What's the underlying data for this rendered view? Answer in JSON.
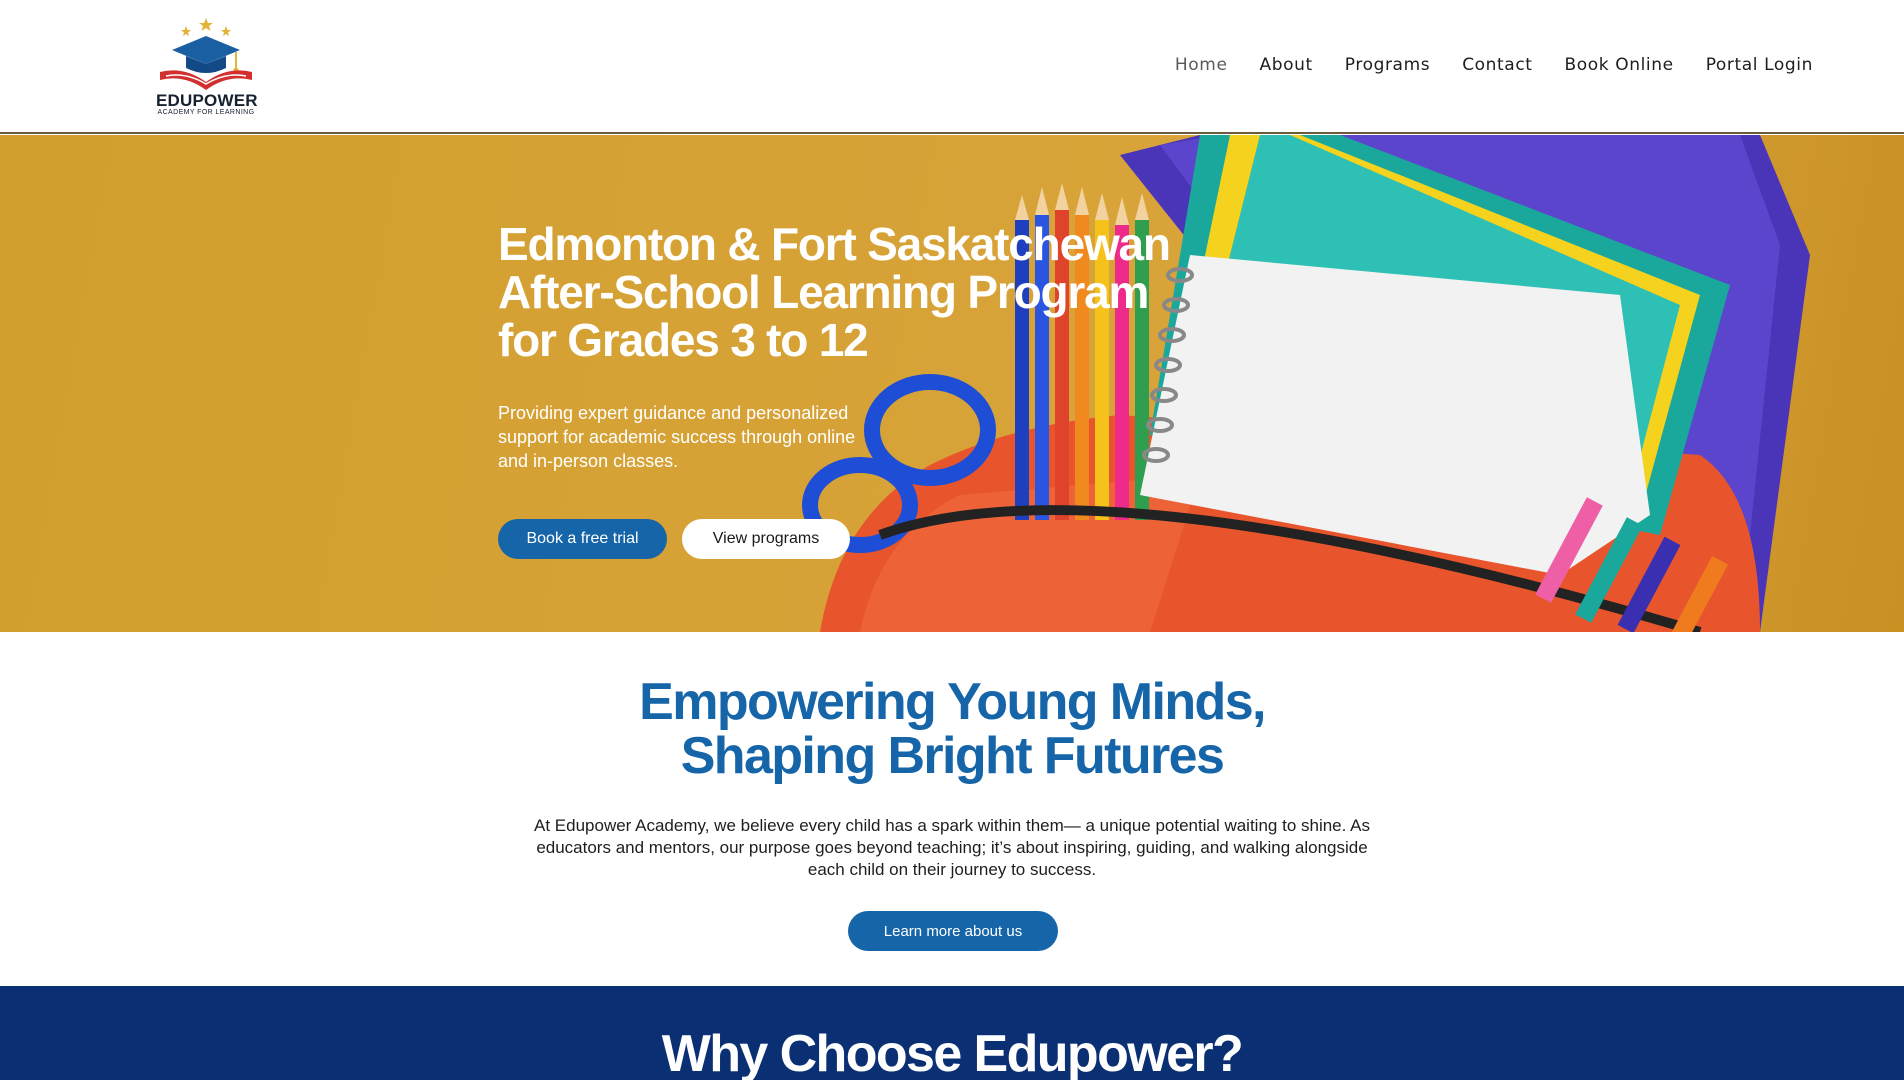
{
  "brand": {
    "name": "EDUPOWER",
    "tagline": "ACADEMY FOR LEARNING"
  },
  "nav": {
    "items": [
      "Home",
      "About",
      "Programs",
      "Contact",
      "Book Online",
      "Portal Login"
    ],
    "active": "Home"
  },
  "hero": {
    "title_lines": [
      "Edmonton & Fort Saskatchewan",
      "After-School Learning Program",
      "for Grades 3 to 12"
    ],
    "subtitle": "Providing expert guidance and personalized support for academic success through online and in-person classes.",
    "primary_button": "Book a free trial",
    "secondary_button": "View programs"
  },
  "about": {
    "title_lines": [
      "Empowering Young Minds,",
      "Shaping Bright Futures"
    ],
    "body": "At Edupower Academy, we believe every child has a spark within them— a unique potential waiting to shine. As educators and mentors, our purpose goes beyond teaching; it’s about inspiring, guiding, and walking alongside each child on their journey to success.",
    "button": "Learn more about us"
  },
  "why": {
    "title": "Why Choose Edupower?"
  },
  "colors": {
    "brand_blue": "#1565a8",
    "navy": "#0b2f73",
    "hero_gold": "#d6a236",
    "logo_red": "#d32f2f"
  }
}
